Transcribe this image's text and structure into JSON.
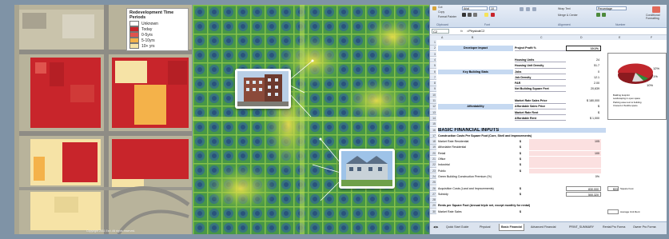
{
  "map": {
    "legend": {
      "title": "Redevelopment Time Periods",
      "items": [
        {
          "label": "Unknown",
          "color": "#ffffff"
        },
        {
          "label": "Today",
          "color": "#c8252b"
        },
        {
          "label": "0-5yrs",
          "color": "#e0544e"
        },
        {
          "label": "5-10yrs",
          "color": "#f4b24a"
        },
        {
          "label": "10+ yrs",
          "color": "#f6e3a6"
        }
      ]
    },
    "footer": "Copyright 2011 Esri. All rights reserved."
  },
  "excel": {
    "ribbon": {
      "cut": "Cut",
      "copy": "Copy",
      "format_painter": "Format Painter",
      "font_name": "Arial",
      "font_size": "10",
      "wrap_text": "Wrap Text",
      "merge_center": "Merge & Center",
      "number_format": "Percentage",
      "conditional_formatting": "Conditional Formatting",
      "groups": [
        "Clipboard",
        "Font",
        "Alignment",
        "Number"
      ]
    },
    "name_box": "C2",
    "formula": "=PhysicalC2",
    "columns": [
      "A",
      "B",
      "C",
      "D",
      "E",
      "F"
    ],
    "rows": [
      {
        "n": "1",
        "b": "",
        "c": "",
        "d": ""
      },
      {
        "n": "2",
        "b": "Developer Impact",
        "c": "Project Profit %",
        "d": "10.1%"
      },
      {
        "n": "3",
        "b": "",
        "c": "",
        "d": ""
      },
      {
        "n": "4",
        "b": "",
        "c": "Housing Units",
        "d": "24"
      },
      {
        "n": "5",
        "b": "",
        "c": "Housing Unit Density",
        "d": "51.7"
      },
      {
        "n": "6",
        "b": "Key Building Stats",
        "c": "Jobs",
        "d": "0"
      },
      {
        "n": "7",
        "b": "",
        "c": "Job Density",
        "d": "12.1"
      },
      {
        "n": "8",
        "b": "",
        "c": "FAR",
        "d": "2.00"
      },
      {
        "n": "9",
        "b": "",
        "c": "Net Building Square Feet",
        "d": "20,639"
      },
      {
        "n": "10",
        "b": "",
        "c": "",
        "d": ""
      },
      {
        "n": "11",
        "b": "",
        "c": "Market Rate Sales Price",
        "d": "$ 180,000"
      },
      {
        "n": "12",
        "b": "Affordability",
        "c": "Affordable Sales Price",
        "d": "$"
      },
      {
        "n": "13",
        "b": "",
        "c": "Market Rate Rent",
        "d": "$"
      },
      {
        "n": "14",
        "b": "",
        "c": "Affordable Rent",
        "d": "$ 1,000"
      },
      {
        "n": "15",
        "b": "",
        "c": "",
        "d": ""
      },
      {
        "n": "16",
        "b": "BASIC FINANCIAL INPUTS",
        "c": "",
        "d": ""
      },
      {
        "n": "17",
        "b": "Construction Costs Per Square Foot (Core, Shell and Improvements)",
        "c": "",
        "d": ""
      },
      {
        "n": "18",
        "b": "Market Rate Residential",
        "c": "$",
        "d": "105"
      },
      {
        "n": "19",
        "b": "Affordable Residential",
        "c": "$",
        "d": ""
      },
      {
        "n": "20",
        "b": "Retail",
        "c": "$",
        "d": "100"
      },
      {
        "n": "21",
        "b": "Office",
        "c": "$",
        "d": ""
      },
      {
        "n": "22",
        "b": "Industrial",
        "c": "$",
        "d": ""
      },
      {
        "n": "23",
        "b": "Public",
        "c": "$",
        "d": ""
      },
      {
        "n": "24",
        "b": "Green Building Construction Premium (%)",
        "c": "",
        "d": "0%"
      },
      {
        "n": "25",
        "b": "",
        "c": "",
        "d": ""
      },
      {
        "n": "26",
        "b": "Acquisition Costs (Land and Improvements)",
        "c": "$",
        "d": "830,000"
      },
      {
        "n": "27",
        "b": "Subsidy",
        "c": "$",
        "d": "500,320"
      },
      {
        "n": "28",
        "b": "",
        "c": "",
        "d": ""
      },
      {
        "n": "29",
        "b": "Rents per Square Foot (Annual triple net, except monthly for rental)",
        "c": "",
        "d": ""
      },
      {
        "n": "30",
        "b": "Market Rate Sales",
        "c": "$",
        "d": ""
      }
    ],
    "side_notes": [
      {
        "row": "26",
        "value": "$33",
        "label": "Square Foot"
      },
      {
        "row": "30",
        "value": "",
        "label": "Average Unit Rent"
      }
    ],
    "pie": {
      "labels": [
        "12%",
        "1%",
        "10%"
      ],
      "legend": [
        "Building footprint",
        "Landscaping in open space",
        "Parking area next to building",
        "Unused or flexible space"
      ],
      "colors": [
        "#c0272d",
        "#2e8b3a",
        "#d9d9d9",
        "#3b6cb3"
      ]
    },
    "sheet_tabs": [
      "Quick Start Guide",
      "Physical",
      "Basic Financial",
      "Advanced Financial",
      "PRINT_SUMMARY",
      "Rental Pro Forma",
      "Owner Pro Forma"
    ],
    "active_tab": "Basic Financial"
  }
}
